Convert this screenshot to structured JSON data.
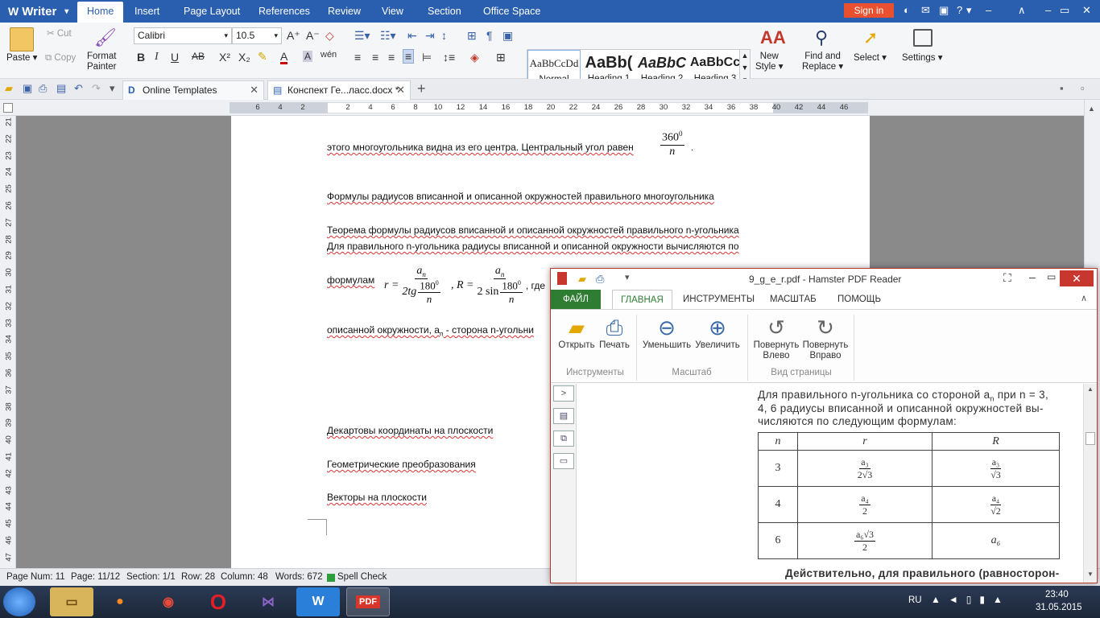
{
  "app": {
    "name": "Writer",
    "menu_tabs": [
      "Home",
      "Insert",
      "Page Layout",
      "References",
      "Review",
      "View",
      "Section",
      "Office Space"
    ],
    "active_tab": "Home",
    "sign_in": "Sign in"
  },
  "ribbon": {
    "paste": "Paste",
    "cut": "Cut",
    "copy": "Copy",
    "format_painter": [
      "Format",
      "Painter"
    ],
    "font_name": "Calibri",
    "font_size": "10.5",
    "styles": [
      {
        "sample": "AaBbCcDd",
        "name": "Normal"
      },
      {
        "sample": "AaBb(",
        "name": "Heading 1"
      },
      {
        "sample": "AaBbC",
        "name": "Heading 2"
      },
      {
        "sample": "AaBbCc",
        "name": "Heading 3"
      }
    ],
    "new_style": [
      "New",
      "Style"
    ],
    "find_replace": [
      "Find and",
      "Replace"
    ],
    "select": "Select",
    "settings": "Settings"
  },
  "doc_tabs": [
    {
      "label": "Online Templates"
    },
    {
      "label": "Конспект Ге...ласс.docx *"
    }
  ],
  "ruler_h": [
    "6",
    "4",
    "2",
    "",
    "2",
    "4",
    "6",
    "8",
    "10",
    "12",
    "14",
    "16",
    "18",
    "20",
    "22",
    "24",
    "26",
    "28",
    "30",
    "32",
    "34",
    "36",
    "38",
    "40",
    "42",
    "44",
    "46"
  ],
  "ruler_v": [
    "21",
    "22",
    "23",
    "24",
    "25",
    "26",
    "27",
    "28",
    "29",
    "30",
    "31",
    "32",
    "33",
    "34",
    "35",
    "36",
    "37",
    "38",
    "39",
    "40",
    "41",
    "42",
    "43",
    "44",
    "45",
    "46",
    "47"
  ],
  "document": {
    "line1": "этого многоугольника видна из его центра. Центральный угол равен",
    "line1_frac_num": "360",
    "line1_frac_sup": "0",
    "line1_frac_den": "n",
    "heading1": "Формулы радиусов вписанной и описанной окружностей правильного многоугольника",
    "theorem": "Теорема формулы радиусов вписанной и описанной окружностей правильного n-угольника",
    "para": "Для правильного n-угольника радиусы вписанной и описанной окружности вычисляются по",
    "formulas_label": "формулам",
    "formula_r": "r =",
    "formula_R": ", R =",
    "formula_an": "a",
    "formula_an_sub": "n",
    "formula_tg": "2tg",
    "formula_sin": "2 sin",
    "formula_180": "180",
    "formula_deg": "0",
    "formula_n": "n",
    "formula_tail": ", где",
    "line_desc": "описанной окружности, a",
    "line_desc_sub": "n",
    "line_desc_tail": " - сторона n-угольни",
    "heading2": "Декартовы координаты на плоскости",
    "heading3": "Геометрические преобразования",
    "heading4": "Векторы на плоскости"
  },
  "status": {
    "page_num": "Page Num: 11",
    "page": "Page: 11/12",
    "section": "Section: 1/1",
    "row": "Row: 28",
    "column": "Column: 48",
    "words": "Words: 672",
    "spell": "Spell Check"
  },
  "pdf": {
    "title": "9_g_e_r.pdf - Hamster PDF Reader",
    "tabs": [
      "ФАЙЛ",
      "ГЛАВНАЯ",
      "ИНСТРУМЕНТЫ",
      "МАСШТАБ",
      "ПОМОЩЬ"
    ],
    "buttons": {
      "open": "Открыть",
      "print": "Печать",
      "zoom_out": "Уменьшить",
      "zoom_in": "Увеличить",
      "rotate_left": [
        "Повернуть",
        "Влево"
      ],
      "rotate_right": [
        "Повернуть",
        "Вправо"
      ]
    },
    "groups": [
      "Инструменты",
      "Масштаб",
      "Вид страницы"
    ],
    "scan_lines": [
      "Для правильного n-угольника со стороной a",
      "4, 6 радиусы вписанной и описанной окружностей вы-",
      "числяются по следующим формулам:"
    ],
    "scan_line1_tail": " при n = 3,",
    "scan_sub": "n",
    "table_headers": [
      "n",
      "r",
      "R"
    ],
    "table_rows": [
      {
        "n": "3",
        "r_num": "a₃",
        "r_den": "2√3",
        "R_num": "a₃",
        "R_den": "√3"
      },
      {
        "n": "4",
        "r_num": "a₄",
        "r_den": "2",
        "R_num": "a₄",
        "R_den": "√2"
      },
      {
        "n": "6",
        "r_num": "a₆√3",
        "r_den": "2",
        "R": "a₆"
      }
    ],
    "scan_bottom": "Действительно, для правильного (равносторон-"
  },
  "taskbar": {
    "lang": "RU",
    "time": "23:40",
    "date": "31.05.2015"
  },
  "colors": {
    "writer_blue": "#2a5fb0",
    "signin_orange": "#e8502f",
    "pdf_green": "#2e7d32",
    "close_red": "#c7372e"
  }
}
